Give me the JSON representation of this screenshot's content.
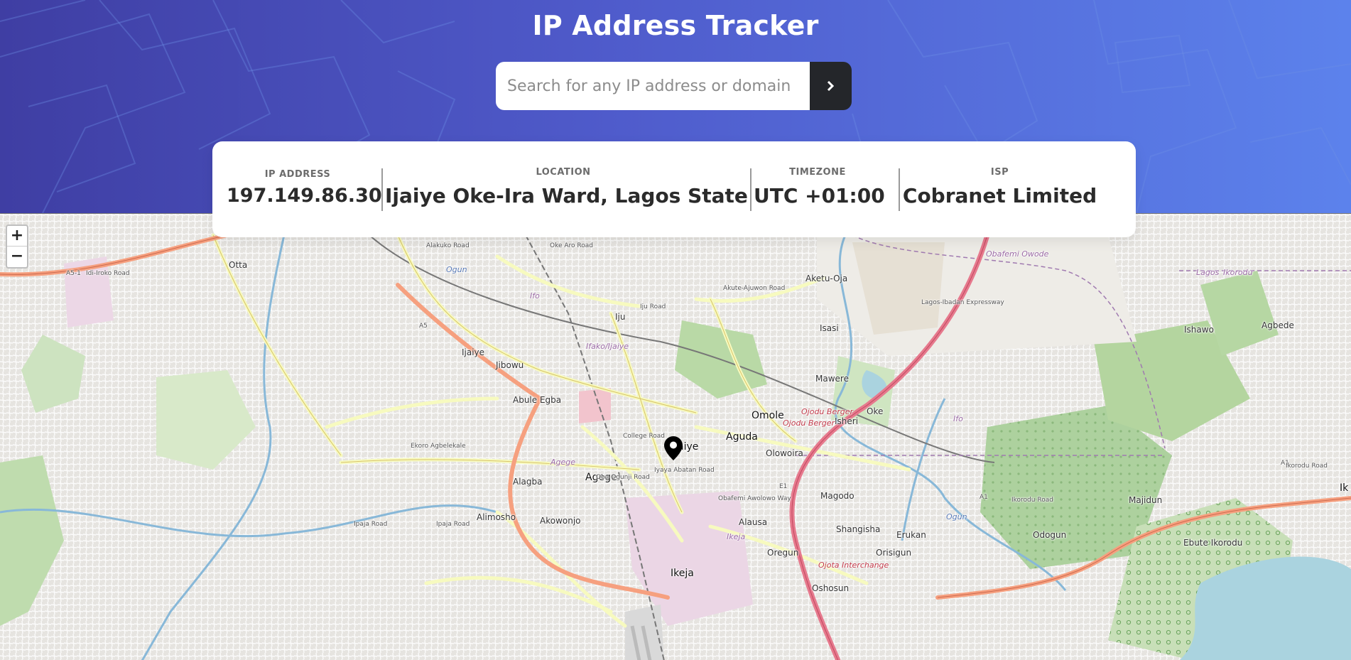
{
  "header": {
    "title": "IP Address Tracker",
    "search": {
      "placeholder": "Search for any IP address or domain",
      "value": "",
      "submit_icon": "chevron-right-icon"
    },
    "colors": {
      "gradient_start": "#3f3ea3",
      "gradient_end": "#5c82ec",
      "button": "#24262a"
    }
  },
  "info": {
    "ip_address": {
      "label": "IP ADDRESS",
      "value": "197.149.86.30"
    },
    "location": {
      "label": "LOCATION",
      "value": "Ijaiye Oke-Ira Ward, Lagos State"
    },
    "timezone": {
      "label": "TIMEZONE",
      "value": "UTC +01:00"
    },
    "isp": {
      "label": "ISP",
      "value": "Cobranet Limited"
    }
  },
  "map": {
    "zoom_in": "+",
    "zoom_out": "−",
    "marker_icon": "map-pin-icon",
    "places": {
      "otta": "Otta",
      "ijaiye_w": "Ijaiye",
      "jibowu": "Jibowu",
      "iju": "Iju",
      "ifako_ijaiye": "Ifako/Ijaiye",
      "abule_egba": "Abule Egba",
      "ijaiye": "Ijaiye",
      "aguda": "Aguda",
      "omole": "Omole",
      "olowoira": "Olowoira",
      "agege": "Agege",
      "agege_river": "Agege",
      "alagba": "Alagba",
      "alimosho": "Alimosho",
      "akowonjo": "Akowonjo",
      "magodo": "Magodo",
      "alausa": "Alausa",
      "ikeja": "Ikeja",
      "ikeja_area": "Ikeja",
      "oregun": "Oregun",
      "shangisha": "Shangisha",
      "erukan": "Erukan",
      "orisigun": "Orisigun",
      "oshosun": "Oshosun",
      "odogun": "Odogun",
      "majidun": "Majidun",
      "ebute_ikorodu": "Ebute Ikorodu",
      "isheri": "Isheri",
      "oke": "Oke",
      "mawere": "Mawere",
      "isasi": "Isasi",
      "aketu_oja": "Aketu-Oja",
      "ishawo": "Ishawo",
      "agbede": "Agbede",
      "obafemi_owode": "Obafemi Owode",
      "lagos": "Lagos",
      "ikorodu_top": "Ikorodu",
      "ojodu_berger": "Ojodu Berger",
      "ojodu_berger2": "Ojodu Berger",
      "ojota": "Ojota Interchange",
      "ifo": "Ifo",
      "ifo2": "Ifo",
      "ogun": "Ogun",
      "ogun2": "Ogun",
      "ik_edge": "Ik",
      "a5_1": "A5-1",
      "a5": "A5",
      "a1": "A1",
      "a1b": "A1",
      "e1": "E1",
      "idi_iroko": "Idi-Iroko Road",
      "alakuko": "Alakuko Road",
      "oke_aro": "Oke Aro Road",
      "iju_road": "Iju Road",
      "akute": "Akute-Ajuwon Road",
      "ikorodu_road": "Ikorodu Road",
      "ikorodu_road2": "Ikorodu Road",
      "ekoro": "Ekoro Agbelekale",
      "iyana_ipaja": "Ipaja Road",
      "ipaja_road": "Ipaja Road",
      "lagos_ibadan": "Lagos-Ibadan Expressway",
      "college": "College Road",
      "abatan": "Iyaya Abatan Road",
      "oba_ogunji": "Oba Ogunji Road",
      "obafemi_awolowo": "Obafemi Awolowo Way"
    }
  }
}
